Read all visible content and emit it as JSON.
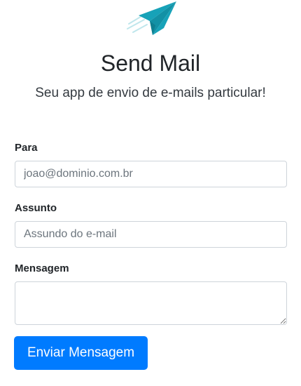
{
  "header": {
    "logo_icon": "paper-plane-icon",
    "logo_color": "#17a2b8",
    "title": "Send Mail",
    "subtitle": "Seu app de envio de e-mails particular!"
  },
  "form": {
    "to_label": "Para",
    "to_placeholder": "joao@dominio.com.br",
    "to_value": "",
    "subject_label": "Assunto",
    "subject_placeholder": "Assundo do e-mail",
    "subject_value": "",
    "message_label": "Mensagem",
    "message_value": "",
    "submit_label": "Enviar Mensagem"
  },
  "colors": {
    "primary": "#007bff",
    "input_border": "#ced4da"
  }
}
